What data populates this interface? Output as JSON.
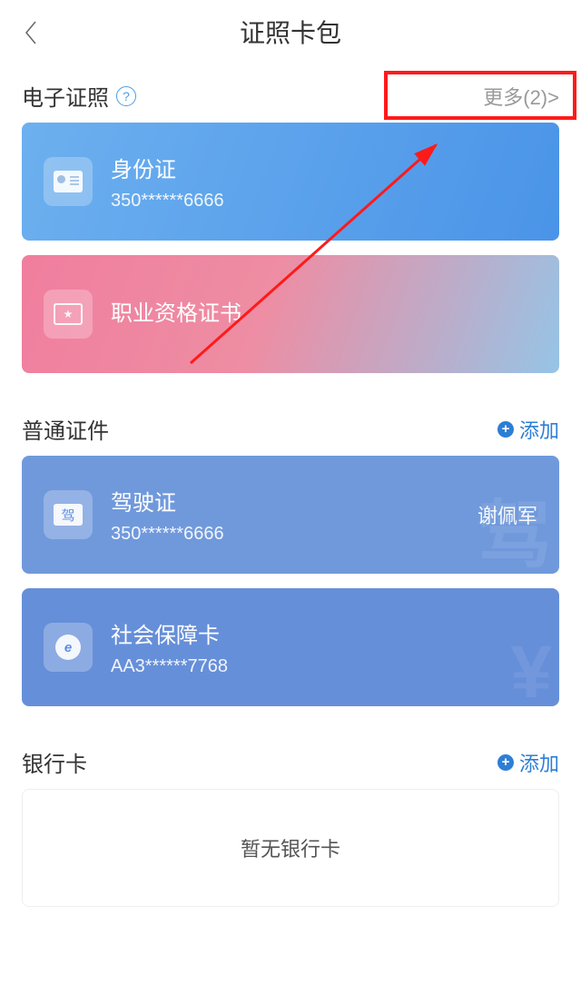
{
  "header": {
    "title": "证照卡包"
  },
  "section_electronic": {
    "title": "电子证照",
    "more": "更多(2)>"
  },
  "cards_electronic": [
    {
      "title": "身份证",
      "sub": "350******6666",
      "icon": "idcard",
      "bg": "card-blue1"
    },
    {
      "title": "职业资格证书",
      "sub": "",
      "icon": "cert",
      "bg": "card-pink"
    }
  ],
  "section_normal": {
    "title": "普通证件",
    "add": "添加"
  },
  "cards_normal": [
    {
      "title": "驾驶证",
      "sub": "350******6666",
      "right": "谢佩军",
      "icon": "driver",
      "iconText": "驾",
      "bg": "card-blue2",
      "watermark": "驾"
    },
    {
      "title": "社会保障卡",
      "sub": "AA3******7768",
      "right": "",
      "icon": "ecard",
      "iconText": "e",
      "bg": "card-blue3",
      "watermark": "¥"
    }
  ],
  "section_bank": {
    "title": "银行卡",
    "add": "添加",
    "empty": "暂无银行卡"
  }
}
